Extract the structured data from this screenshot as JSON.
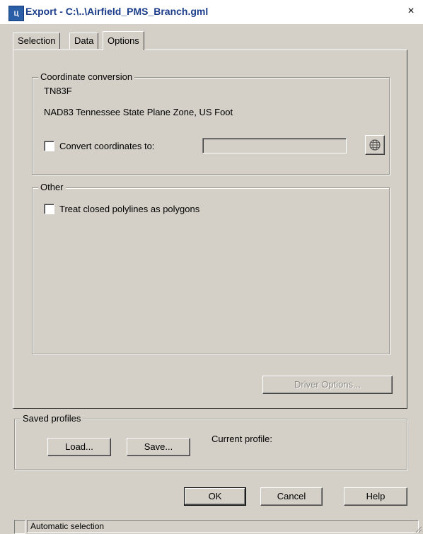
{
  "window": {
    "icon_text": "Ц",
    "title": "Export - C:\\..\\Airfield_PMS_Branch.gml",
    "close_glyph": "×"
  },
  "tabs": [
    {
      "label": "Selection",
      "active": false
    },
    {
      "label": "Data",
      "active": false
    },
    {
      "label": "Options",
      "active": true
    }
  ],
  "coordinate_conversion": {
    "group_label": "Coordinate conversion",
    "code": "TN83F",
    "description": "NAD83 Tennessee State Plane Zone, US Foot",
    "convert_label": "Convert coordinates to:",
    "convert_checked": false,
    "convert_value": "",
    "picker_icon": "globe-icon"
  },
  "other": {
    "group_label": "Other",
    "polygons_label": "Treat closed polylines as polygons",
    "polygons_checked": false
  },
  "driver_options_label": "Driver Options...",
  "saved_profiles": {
    "group_label": "Saved profiles",
    "load_label": "Load...",
    "save_label": "Save...",
    "current_profile_label": "Current profile:"
  },
  "buttons": {
    "ok": "OK",
    "cancel": "Cancel",
    "help": "Help"
  },
  "statusbar": {
    "text": "Automatic selection"
  }
}
